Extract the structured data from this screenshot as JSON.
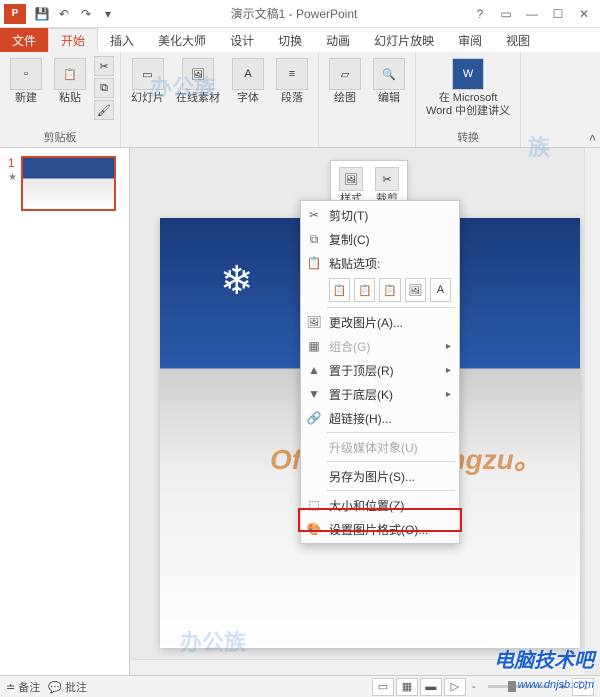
{
  "titlebar": {
    "title": "演示文稿1 - PowerPoint"
  },
  "tabs": {
    "file": "文件",
    "home": "开始",
    "insert": "插入",
    "beautify": "美化大师",
    "design": "设计",
    "transitions": "切换",
    "animations": "动画",
    "slideshow": "幻灯片放映",
    "review": "审阅",
    "view": "视图"
  },
  "ribbon": {
    "new": "新建",
    "paste": "粘贴",
    "clipboard_group": "剪贴板",
    "slides": "幻灯片",
    "online_assets": "在线素材",
    "font": "字体",
    "paragraph": "段落",
    "drawing": "绘图",
    "editing": "编辑",
    "word_handout": "在 Microsoft\nWord 中创建讲义",
    "convert_group": "转换"
  },
  "pictools": {
    "style": "样式",
    "crop": "裁剪"
  },
  "thumbnail": {
    "number": "1"
  },
  "slide_text": {
    "watermark": "Office.办公族 ngzu。"
  },
  "context_menu": {
    "cut": "剪切(T)",
    "copy": "复制(C)",
    "paste_options": "粘贴选项:",
    "change_picture": "更改图片(A)...",
    "group": "组合(G)",
    "bring_front": "置于顶层(R)",
    "send_back": "置于底层(K)",
    "hyperlink": "超链接(H)...",
    "upgrade_media": "升级媒体对象(U)",
    "save_as_picture": "另存为图片(S)...",
    "size_position": "大小和位置(Z)...",
    "format_picture": "设置图片格式(O)..."
  },
  "statusbar": {
    "notes": "备注",
    "comments": "批注",
    "zoom_minus": "-",
    "zoom_plus": "+"
  },
  "site": {
    "name": "电脑技术吧",
    "url": "www.dnjsb.com"
  },
  "bg_watermarks": {
    "w1": "办公族",
    "w2": "办公族",
    "w3": "族"
  }
}
